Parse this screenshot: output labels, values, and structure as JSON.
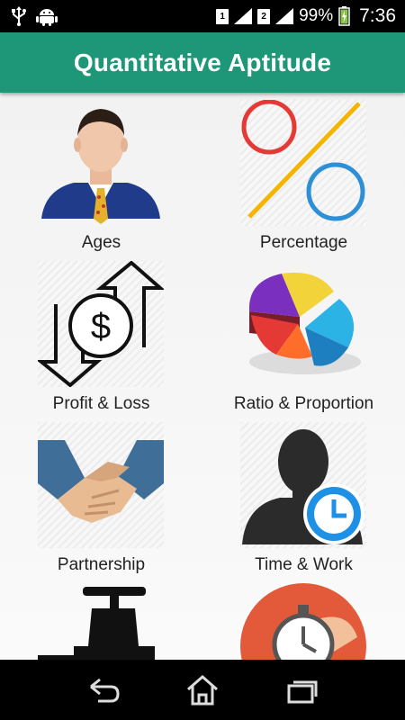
{
  "status_bar": {
    "sim1": "1",
    "sim2": "2",
    "battery": "99%",
    "time": "7:36",
    "icons": [
      "usb-icon",
      "android-icon",
      "signal-icon",
      "battery-charging-icon"
    ]
  },
  "app_bar": {
    "title": "Quantitative Aptitude"
  },
  "categories": [
    {
      "label": "Ages",
      "icon": "businessman-icon"
    },
    {
      "label": "Percentage",
      "icon": "percent-icon"
    },
    {
      "label": "Profit & Loss",
      "icon": "dollar-arrows-icon"
    },
    {
      "label": "Ratio & Proportion",
      "icon": "pie-chart-icon"
    },
    {
      "label": "Partnership",
      "icon": "handshake-icon"
    },
    {
      "label": "Time & Work",
      "icon": "person-clock-icon"
    },
    {
      "label": "",
      "icon": "faucet-icon"
    },
    {
      "label": "",
      "icon": "stopwatch-icon"
    }
  ],
  "nav_bar": {
    "icons": [
      "back-icon",
      "home-icon",
      "recents-icon"
    ]
  },
  "colors": {
    "app_bar": "#1e9678",
    "status_bar": "#000000",
    "nav_bar": "#000000"
  }
}
